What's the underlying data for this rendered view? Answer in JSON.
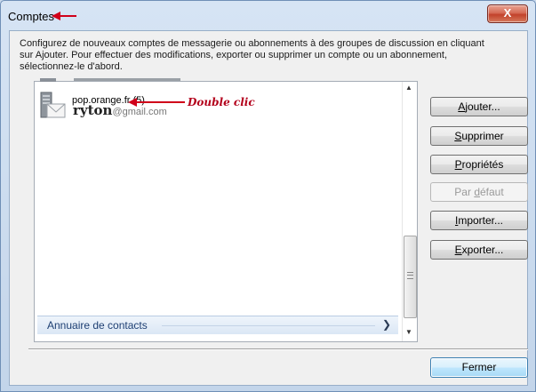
{
  "window": {
    "title": "Comptes",
    "close_glyph": "X"
  },
  "description": {
    "line1": "Configurez de nouveaux comptes de messagerie ou abonnements à des groupes de discussion en cliquant",
    "line2": "sur Ajouter. Pour effectuer des modifications, exporter ou supprimer un compte ou un abonnement,",
    "line3": "sélectionnez-le d'abord."
  },
  "accounts": {
    "item": {
      "name": "pop.orange.fr (5)",
      "user_bold": "ryton",
      "user_domain": "@gmail.com",
      "icon": "mail-server-icon"
    },
    "annotation": "Double clic",
    "contacts_label": "Annuaire de contacts"
  },
  "buttons": {
    "ajouter": {
      "prefix": "",
      "accel": "A",
      "rest": "jouter..."
    },
    "supprimer": {
      "prefix": "",
      "accel": "S",
      "rest": "upprimer"
    },
    "proprietes": {
      "prefix": "",
      "accel": "P",
      "rest": "ropriétés"
    },
    "par_defaut": {
      "prefix": "Par ",
      "accel": "d",
      "rest": "éfaut"
    },
    "importer": {
      "prefix": "",
      "accel": "I",
      "rest": "mporter..."
    },
    "exporter": {
      "prefix": "",
      "accel": "E",
      "rest": "xporter..."
    },
    "fermer": "Fermer"
  },
  "colors": {
    "annotation": "#b3001b",
    "accent": "#3c7fb1"
  }
}
